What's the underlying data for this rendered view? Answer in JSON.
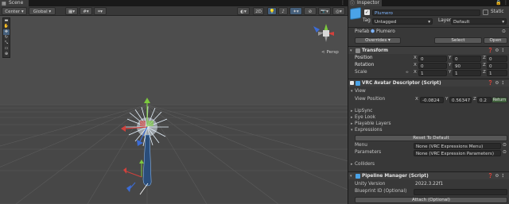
{
  "scene": {
    "tab_label": "Scene",
    "toolbar": {
      "pivot_mode": "Center",
      "pivot_rotation": "Global",
      "mode_2d": "2D"
    },
    "gizmo_projection": "< Persp"
  },
  "inspector": {
    "tab_label": "Inspector",
    "object_name": "Plumero",
    "static_label": "Static",
    "tag_label": "Tag",
    "tag_value": "Untagged",
    "layer_label": "Layer",
    "layer_value": "Default",
    "prefab_label": "Prefab",
    "prefab_value": "Plumero",
    "overrides_label": "Overrides",
    "select_label": "Select",
    "open_label": "Open",
    "transform": {
      "title": "Transform",
      "position_label": "Position",
      "rotation_label": "Rotation",
      "scale_label": "Scale",
      "position": {
        "x": "0",
        "y": "0",
        "z": "0"
      },
      "rotation": {
        "x": "0",
        "y": "90",
        "z": "0"
      },
      "scale": {
        "x": "1",
        "y": "1",
        "z": "1"
      }
    },
    "avatar_descriptor": {
      "title": "VRC Avatar Descriptor (Script)",
      "view_section": "View",
      "view_position_label": "View Position",
      "view_position": {
        "x": "-0.0824",
        "y": "0.56347",
        "z": "0.2"
      },
      "return_label": "Return",
      "lipsync_label": "LipSync",
      "eye_look_label": "Eye Look",
      "playable_layers_label": "Playable Layers",
      "expressions_label": "Expressions",
      "reset_default_label": "Reset To Default",
      "menu_label": "Menu",
      "menu_value": "None (VRC Expressions Menu)",
      "parameters_label": "Parameters",
      "parameters_value": "None (VRC Expression Parameters)",
      "colliders_label": "Colliders"
    },
    "pipeline_manager": {
      "title": "Pipeline Manager (Script)",
      "unity_version_label": "Unity Version",
      "unity_version_value": "2022.3.22f1",
      "blueprint_label": "Blueprint ID (Optional)",
      "blueprint_value": "",
      "attach_label": "Attach (Optional)"
    }
  },
  "colors": {
    "axis_x": "#d2413c",
    "axis_y": "#7cc93e",
    "axis_z": "#3c6cd6",
    "selection": "#46607c",
    "return_green": "#3e5e3a"
  }
}
